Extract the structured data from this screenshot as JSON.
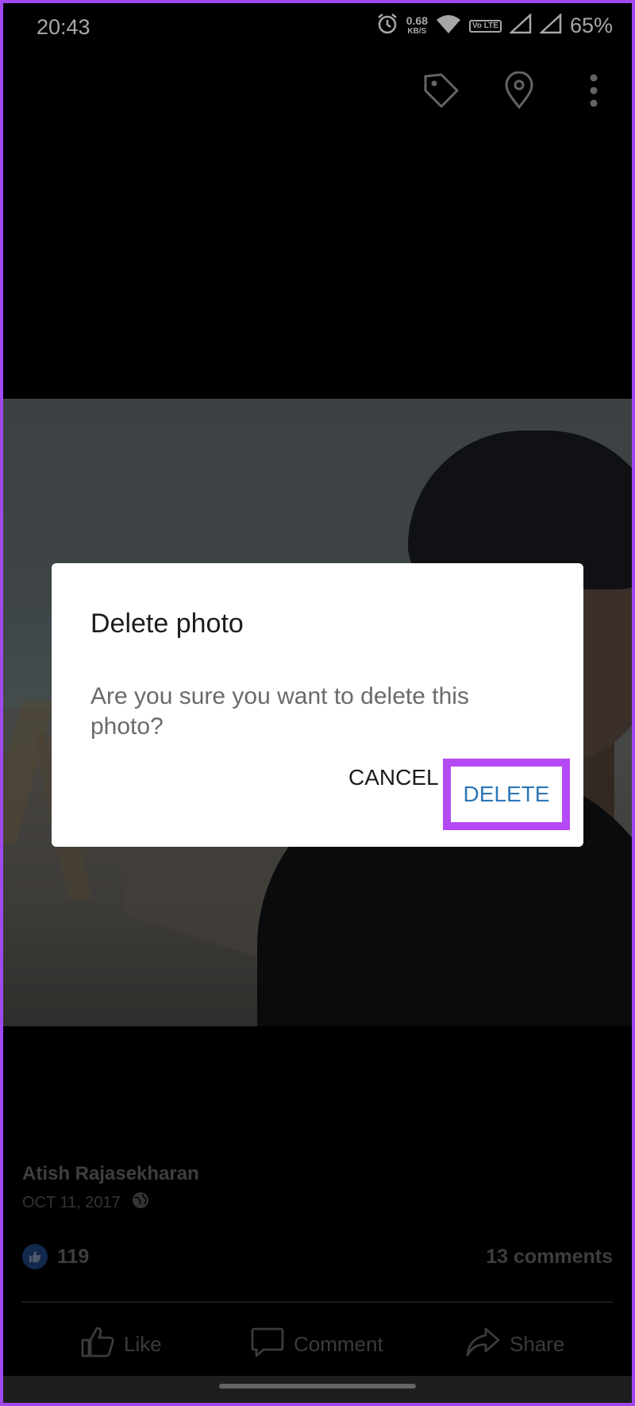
{
  "status_bar": {
    "time": "20:43",
    "net_speed_value": "0.68",
    "net_speed_unit": "KB/S",
    "volte_label": "Vo LTE",
    "battery": "65%"
  },
  "top_actions": {
    "icons": [
      "tag-icon",
      "location-pin-icon",
      "more-vert-icon"
    ]
  },
  "post": {
    "author": "Atish Rajasekharan",
    "date": "OCT 11, 2017",
    "likes": "119",
    "comments": "13 comments",
    "actions": {
      "like": "Like",
      "comment": "Comment",
      "share": "Share"
    }
  },
  "dialog": {
    "title": "Delete photo",
    "message": "Are you sure you want to delete this photo?",
    "cancel_label": "CANCEL",
    "delete_label": "DELETE"
  },
  "colors": {
    "frame_border": "#a049f0",
    "highlight": "#b34af5",
    "delete_text": "#2f78b7",
    "like_badge": "#1d3f78"
  }
}
